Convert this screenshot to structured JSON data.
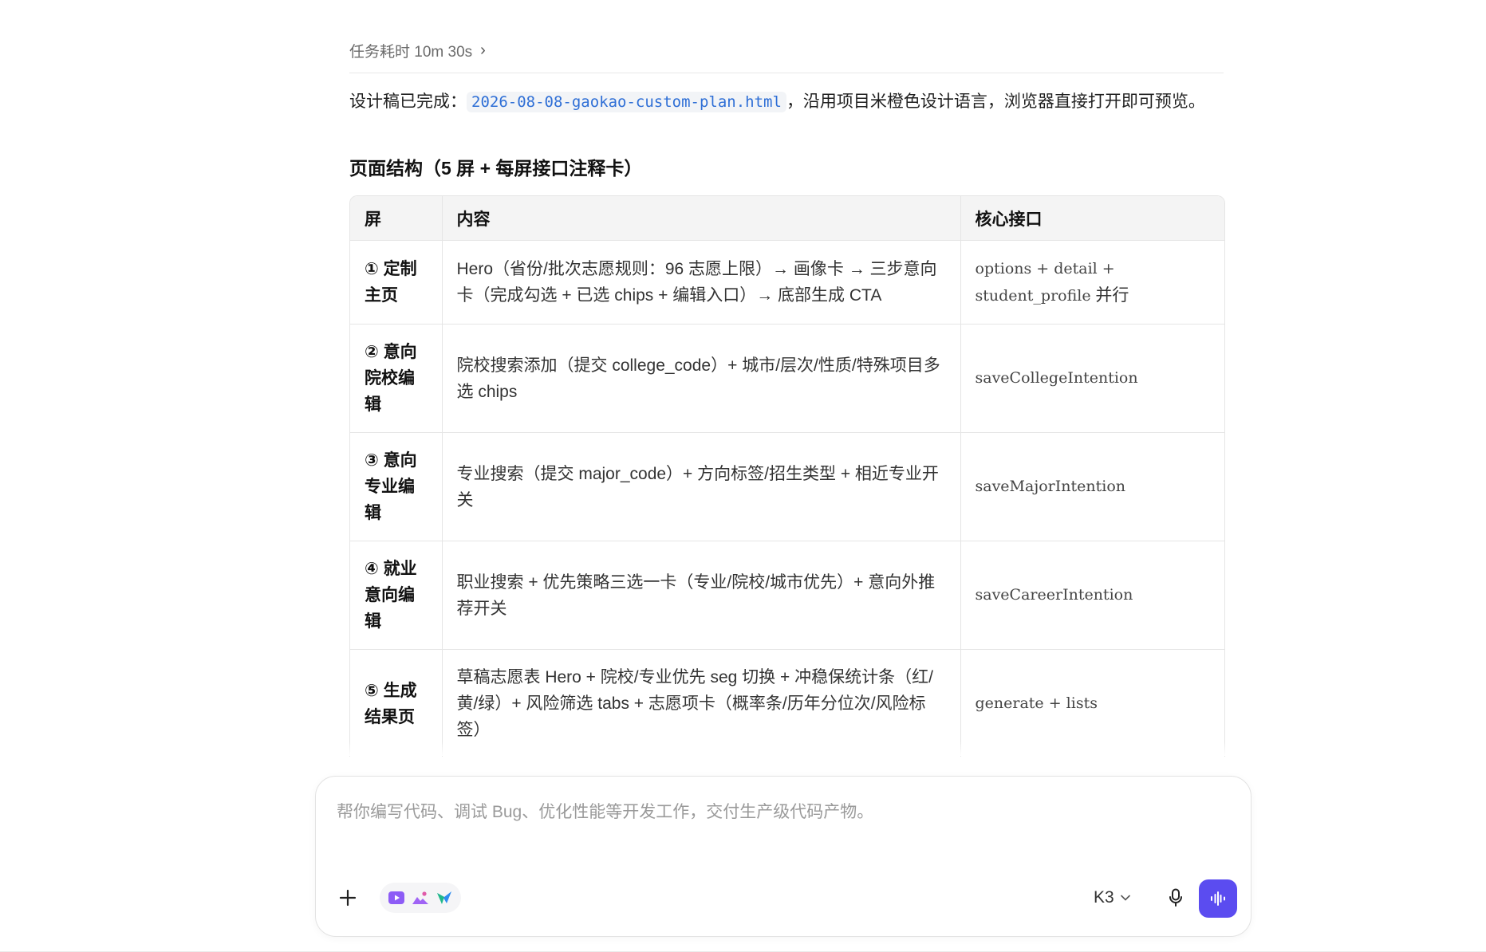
{
  "task": {
    "duration_label": "任务耗时 10m 30s",
    "chevron": "›"
  },
  "summary": {
    "prefix": "设计稿已完成：",
    "filename": "2026-08-08-gaokao-custom-plan.html",
    "suffix": "，沿用项目米橙色设计语言，浏览器直接打开即可预览。"
  },
  "section_title": "页面结构（5 屏 + 每屏接口注释卡）",
  "table": {
    "headers": [
      "屏",
      "内容",
      "核心接口"
    ],
    "rows": [
      {
        "screen": "① 定制主页",
        "content": "Hero（省份/批次志愿规则：96 志愿上限）→ 画像卡 → 三步意向卡（完成勾选 + 已选 chips + 编辑入口）→ 底部生成 CTA",
        "api_parts": [
          "options + detail + ",
          "student_profile",
          " 并行"
        ]
      },
      {
        "screen": "② 意向院校编辑",
        "content": "院校搜索添加（提交 college_code）+ 城市/层次/性质/特殊项目多选 chips",
        "api": "saveCollegeIntention"
      },
      {
        "screen": "③ 意向专业编辑",
        "content": "专业搜索（提交 major_code）+ 方向标签/招生类型 + 相近专业开关",
        "api": "saveMajorIntention"
      },
      {
        "screen": "④ 就业意向编辑",
        "content": "职业搜索 + 优先策略三选一卡（专业/院校/城市优先）+ 意向外推荐开关",
        "api": "saveCareerIntention"
      },
      {
        "screen": "⑤ 生成结果页",
        "content": "草稿志愿表 Hero + 院校/专业优先 seg 切换 + 冲稳保统计条（红/黄/绿）+ 风险筛选 tabs + 志愿项卡（概率条/历年分位次/风险标签）",
        "api": "generate + lists"
      }
    ]
  },
  "composer": {
    "placeholder": "帮你编写代码、调试 Bug、优化性能等开发工作，交付生产级代码产物。",
    "model": "K3"
  },
  "colors": {
    "accent": "#5b4cf0",
    "link": "#2f6fd6"
  }
}
